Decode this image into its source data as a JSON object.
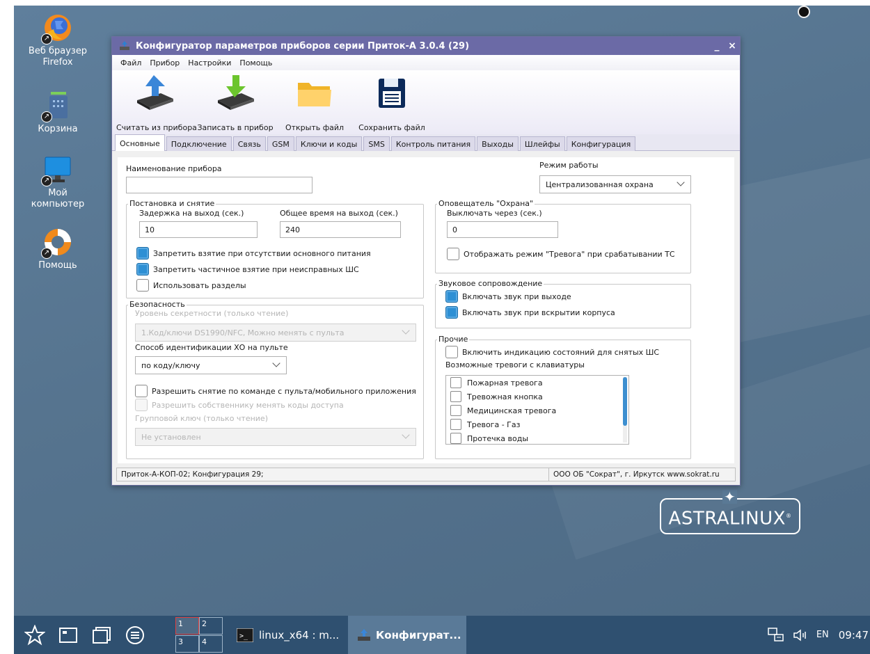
{
  "desktop": {
    "icons": [
      {
        "label_line1": "Веб браузер",
        "label_line2": "Firefox",
        "icon": "firefox-icon"
      },
      {
        "label_line1": "Корзина",
        "label_line2": "",
        "icon": "trash-icon"
      },
      {
        "label_line1": "Мой",
        "label_line2": "компьютер",
        "icon": "computer-icon"
      },
      {
        "label_line1": "Помощь",
        "label_line2": "",
        "icon": "help-lifebuoy-icon"
      }
    ],
    "brand": "ASTRALINUX"
  },
  "window": {
    "title": "Конфигуратор параметров приборов серии Приток-А 3.0.4 (29)",
    "minimize": "_",
    "close": "×",
    "menu": [
      "Файл",
      "Прибор",
      "Настройки",
      "Помощь"
    ],
    "toolbar": {
      "read": "Считать из прибора",
      "write": "Записать в прибор",
      "open": "Открыть файл",
      "save": "Сохранить файл"
    },
    "tabs": [
      "Основные",
      "Подключение",
      "Связь",
      "GSM",
      "Ключи и коды",
      "SMS",
      "Контроль питания",
      "Выходы",
      "Шлейфы",
      "Конфигурация"
    ],
    "active_tab": 0
  },
  "main": {
    "device_name_label": "Наименование прибора",
    "device_name_value": "",
    "mode_label": "Режим работы",
    "mode_value": "Централизованная охрана",
    "arming": {
      "title": "Постановка и снятие",
      "exit_delay_label": "Задержка на выход (сек.)",
      "exit_delay_value": "10",
      "total_exit_label": "Общее время на выход (сек.)",
      "total_exit_value": "240",
      "cb1": "Запретить взятие при отсутствии основного питания",
      "cb2": "Запретить частичное взятие при неисправных ШС",
      "cb3": "Использовать разделы"
    },
    "security": {
      "title": "Безопасность",
      "level_label": "Уровень секретности (только чтение)",
      "level_value": "1.Код/ключи DS1990/NFC, Можно менять с пульта",
      "ident_label": "Способ идентификации ХО на пульте",
      "ident_value": "по коду/ключу",
      "cb1": "Разрешить снятие по команде с пульта/мобильного приложения",
      "cb2": "Разрешить собственнику менять коды доступа",
      "group_key_label": "Групповой ключ (только чтение)",
      "group_key_value": "Не установлен"
    },
    "notifier": {
      "title": "Оповещатель \"Охрана\"",
      "off_after_label": "Выключать через (сек.)",
      "off_after_value": "0",
      "cb1": "Отображать режим \"Тревога\" при срабатывании ТС"
    },
    "sound": {
      "title": "Звуковое сопровождение",
      "cb1": "Включать звук при выходе",
      "cb2": "Включать звук при вскрытии корпуса"
    },
    "other": {
      "title": "Прочие",
      "cb1": "Включить индикацию состояний для снятых ШС",
      "alarms_label": "Возможные тревоги с клавиатуры",
      "alarms": [
        "Пожарная тревога",
        "Тревожная кнопка",
        "Медицинская тревога",
        "Тревога - Газ",
        "Протечка воды"
      ]
    }
  },
  "status": {
    "left": "Приток-А-КОП-02; Конфигурация 29;",
    "right": "ООО ОБ \"Сократ\", г. Иркутск   www.sokrat.ru"
  },
  "taskbar": {
    "pager": [
      "1",
      "2",
      "3",
      "4"
    ],
    "task1": "linux_x64 : m...",
    "task2": "Конфигурат...",
    "lang": "EN",
    "clock": "09:47"
  },
  "colors": {
    "desktop": "#56748f",
    "titlebar": "#6b6aa6",
    "checkbox_checked": "#2d8fd4",
    "taskbar": "#2f5070"
  }
}
